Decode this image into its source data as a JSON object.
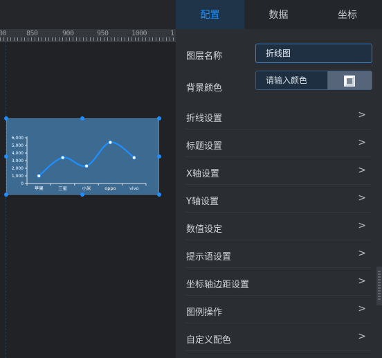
{
  "ruler": {
    "labels": [
      "00",
      "850",
      "900",
      "950",
      "1000",
      "1"
    ]
  },
  "chart_data": {
    "type": "line",
    "categories": [
      "苹果",
      "三星",
      "小米",
      "oppo",
      "vivo"
    ],
    "values": [
      1000,
      3400,
      2300,
      5400,
      3400
    ],
    "y_ticks": [
      "0",
      "1,000",
      "2,000",
      "3,000",
      "4,000",
      "5,000",
      "6,000"
    ],
    "ylim": [
      0,
      6000
    ],
    "line_color": "#1e8fff",
    "background": "#3d6a91",
    "smooth": true
  },
  "panel": {
    "tabs": [
      {
        "label": "配置",
        "active": true
      },
      {
        "label": "数据",
        "active": false
      },
      {
        "label": "坐标",
        "active": false
      }
    ],
    "layer_name": {
      "label": "图层名称",
      "value": "折线图"
    },
    "background_color": {
      "label": "背景颜色",
      "placeholder": "请输入颜色"
    },
    "menu": [
      "折线设置",
      "标题设置",
      "X轴设置",
      "Y轴设置",
      "数值设定",
      "提示语设置",
      "坐标轴边距设置",
      "图例操作",
      "自定义配色"
    ],
    "chevron": ">"
  },
  "colors": {
    "accent": "#1e90ff",
    "panel_bg": "#2a2d31",
    "canvas_bg": "#202225"
  }
}
